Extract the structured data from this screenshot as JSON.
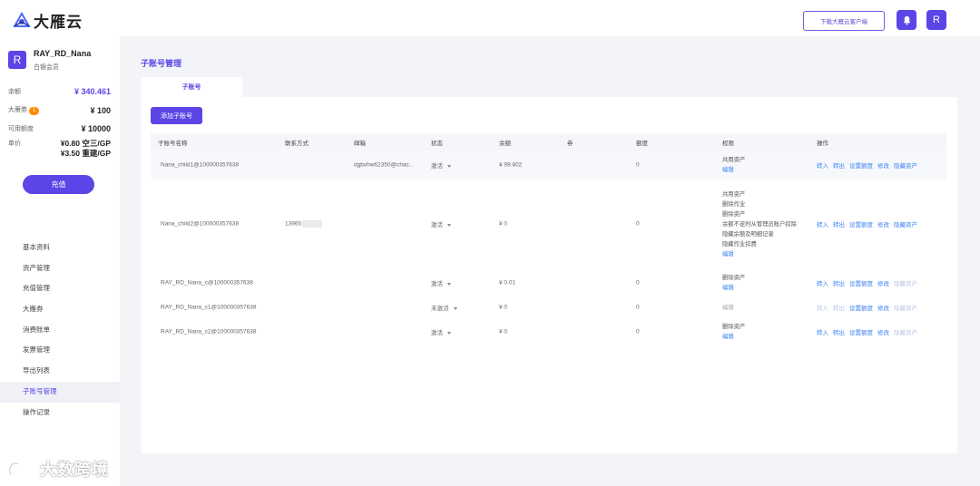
{
  "header": {
    "brand": "大雁云",
    "download_label": "下载大雁云客户端",
    "avatar_letter": "R"
  },
  "user": {
    "avatar_letter": "R",
    "name": "RAY_RD_Nana",
    "level": "白银会员",
    "balance_label": "余额",
    "balance_value": "¥ 340.461",
    "coupon_label": "大雁券",
    "coupon_count": "1",
    "coupon_value": "¥ 100",
    "credit_label": "可用额度",
    "credit_value": "¥ 10000",
    "price_label": "单价",
    "price_line1": "¥0.80 空三/GP",
    "price_line2": "¥3.50 重建/GP",
    "recharge_label": "充值"
  },
  "nav": [
    {
      "label": "基本资料",
      "active": false
    },
    {
      "label": "资产管理",
      "active": false
    },
    {
      "label": "充值管理",
      "active": false
    },
    {
      "label": "大雁券",
      "active": false
    },
    {
      "label": "消费账单",
      "active": false
    },
    {
      "label": "发票管理",
      "active": false
    },
    {
      "label": "导出列表",
      "active": false
    },
    {
      "label": "子账号管理",
      "active": true
    },
    {
      "label": "操作记录",
      "active": false
    }
  ],
  "watermark": "大数跨境",
  "main": {
    "title": "子账号管理",
    "tab": "子账号",
    "add_button": "添加子账号",
    "columns": [
      "子账号名称",
      "联系方式",
      "邮箱",
      "状态",
      "余额",
      "券",
      "额度",
      "权限",
      "操作"
    ],
    "rows": [
      {
        "name": "Nana_child1@100000357638",
        "contact": "",
        "email": "dgbvhw62350@chac...",
        "status": "激活",
        "balance": "¥ 99.802",
        "coupon": "",
        "quota": "0",
        "perms": [
          "共用资产"
        ],
        "edit": "编辑",
        "ops": [
          "转入",
          "转出",
          "设置额度",
          "修改",
          "隐藏资产"
        ],
        "ops_dim": [
          false,
          false,
          false,
          false,
          false
        ]
      },
      {
        "name": "Nana_child2@100000357638",
        "contact": "13965",
        "email": "",
        "status": "激活",
        "balance": "¥ 0",
        "coupon": "",
        "quota": "0",
        "perms": [
          "共用资产",
          "删除作业",
          "删除资产",
          "余额不足时从管理员账户扣除",
          "隐藏余额及明细记录",
          "隐藏作业扣费"
        ],
        "edit": "编辑",
        "ops": [
          "转入",
          "转出",
          "设置额度",
          "修改",
          "隐藏资产"
        ],
        "ops_dim": [
          false,
          false,
          false,
          false,
          false
        ]
      },
      {
        "name": "RAY_RD_Nana_c@100000357638",
        "contact": "",
        "email": "",
        "status": "激活",
        "balance": "¥ 0.01",
        "coupon": "",
        "quota": "0",
        "perms": [
          "删除资产"
        ],
        "edit": "编辑",
        "ops": [
          "转入",
          "转出",
          "设置额度",
          "修改",
          "隐藏资产"
        ],
        "ops_dim": [
          false,
          false,
          false,
          false,
          true
        ]
      },
      {
        "name": "RAY_RD_Nana_c1@100000357638",
        "contact": "",
        "email": "",
        "status": "未激活",
        "balance": "¥ 0",
        "coupon": "",
        "quota": "0",
        "perms": [],
        "edit": "编辑",
        "ops": [
          "转入",
          "转出",
          "设置额度",
          "修改",
          "隐藏资产"
        ],
        "ops_dim": [
          true,
          true,
          false,
          false,
          true
        ]
      },
      {
        "name": "RAY_RD_Nana_c2@100000357638",
        "contact": "",
        "email": "",
        "status": "激活",
        "balance": "¥ 0",
        "coupon": "",
        "quota": "0",
        "perms": [
          "删除资产"
        ],
        "edit": "编辑",
        "ops": [
          "转入",
          "转出",
          "设置额度",
          "修改",
          "隐藏资产"
        ],
        "ops_dim": [
          false,
          false,
          false,
          false,
          true
        ]
      }
    ]
  },
  "colors": {
    "accent": "#5b45e6",
    "link": "#3b82f6",
    "badge": "#ff8a00"
  },
  "icons": {
    "logo": "wild-goose-logo-icon",
    "bell": "bell-icon",
    "caret": "caret-down-icon"
  }
}
